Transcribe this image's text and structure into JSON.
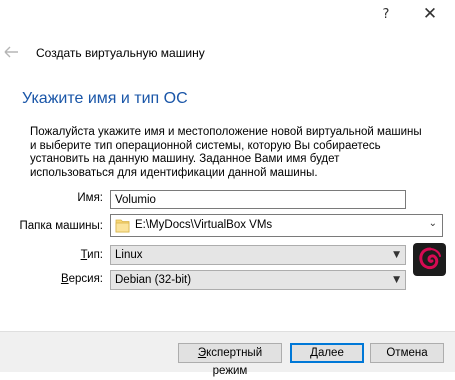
{
  "window": {
    "help_glyph": "?",
    "close_glyph": "✕"
  },
  "wizard": {
    "title": "Создать виртуальную машину",
    "heading": "Укажите имя и тип ОС",
    "description": "Пожалуйста укажите имя и местоположение новой виртуальной машины и выберите тип операционной системы, которую Вы собираетесь установить на данную машину. Заданное Вами имя будет использоваться для идентификации данной машины."
  },
  "form": {
    "name_label": "Имя:",
    "name_value": "Volumio",
    "folder_label": "Папка машины:",
    "folder_value": "E:\\MyDocs\\VirtualBox VMs",
    "type_label_pre": "",
    "type_label_mnemonic": "Т",
    "type_label_post": "ип:",
    "type_value": "Linux",
    "version_label_pre": "",
    "version_label_mnemonic": "В",
    "version_label_post": "ерсия:",
    "version_value": "Debian (32-bit)",
    "os_icon": "debian-logo-icon"
  },
  "buttons": {
    "expert_pre": "",
    "expert_mnemonic": "Э",
    "expert_post": "кспертный режим",
    "next_pre": "",
    "next_mnemonic": "Д",
    "next_post": "алее",
    "cancel": "Отмена"
  },
  "colors": {
    "heading": "#1a56a8",
    "default_button_border": "#0078d7",
    "bottom_bar": "#f0f0f0",
    "debian_red": "#d70a53"
  }
}
